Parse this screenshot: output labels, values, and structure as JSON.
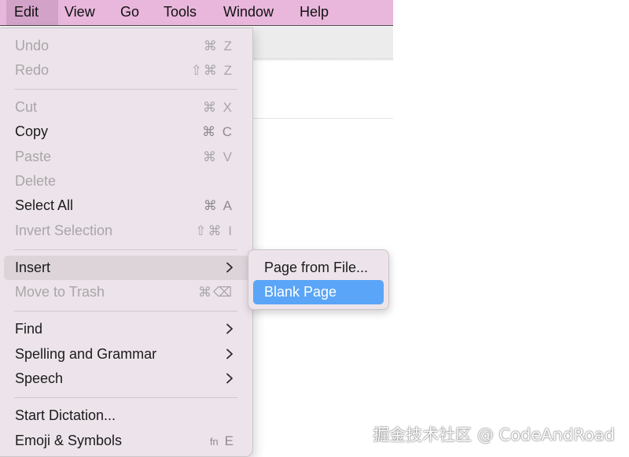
{
  "menubar": {
    "items": [
      {
        "label": "Edit"
      },
      {
        "label": "View"
      },
      {
        "label": "Go"
      },
      {
        "label": "Tools"
      },
      {
        "label": "Window"
      },
      {
        "label": "Help"
      }
    ],
    "active": "Edit"
  },
  "edit_menu": {
    "undo": {
      "label": "Undo",
      "shortcut": "⌘ Z",
      "enabled": false
    },
    "redo": {
      "label": "Redo",
      "shortcut": "⇧⌘ Z",
      "enabled": false
    },
    "cut": {
      "label": "Cut",
      "shortcut": "⌘ X",
      "enabled": false
    },
    "copy": {
      "label": "Copy",
      "shortcut": "⌘ C",
      "enabled": true
    },
    "paste": {
      "label": "Paste",
      "shortcut": "⌘ V",
      "enabled": false
    },
    "delete": {
      "label": "Delete",
      "enabled": false
    },
    "select_all": {
      "label": "Select All",
      "shortcut": "⌘ A",
      "enabled": true
    },
    "invert_selection": {
      "label": "Invert Selection",
      "shortcut": "⇧⌘ I",
      "enabled": false
    },
    "insert": {
      "label": "Insert",
      "has_submenu": true,
      "highlighted": true
    },
    "move_to_trash": {
      "label": "Move to Trash",
      "shortcut": "⌘⌫",
      "enabled": false
    },
    "find": {
      "label": "Find",
      "has_submenu": true
    },
    "spelling": {
      "label": "Spelling and Grammar",
      "has_submenu": true
    },
    "speech": {
      "label": "Speech",
      "has_submenu": true
    },
    "start_dictation": {
      "label": "Start Dictation..."
    },
    "emoji": {
      "label": "Emoji & Symbols",
      "shortcut_fn": "fn",
      "shortcut_key": "E"
    }
  },
  "insert_submenu": {
    "page_from_file": {
      "label": "Page from File..."
    },
    "blank_page": {
      "label": "Blank Page",
      "selected": true
    }
  },
  "icons": {
    "submenu_arrow": "chevron-right-icon"
  },
  "colors": {
    "menubar_bg": "#e9b7dc",
    "menu_bg": "#ece4ea",
    "selection_blue": "#5aa5f7"
  },
  "watermark": "掘金技术社区 @ CodeAndRoad"
}
